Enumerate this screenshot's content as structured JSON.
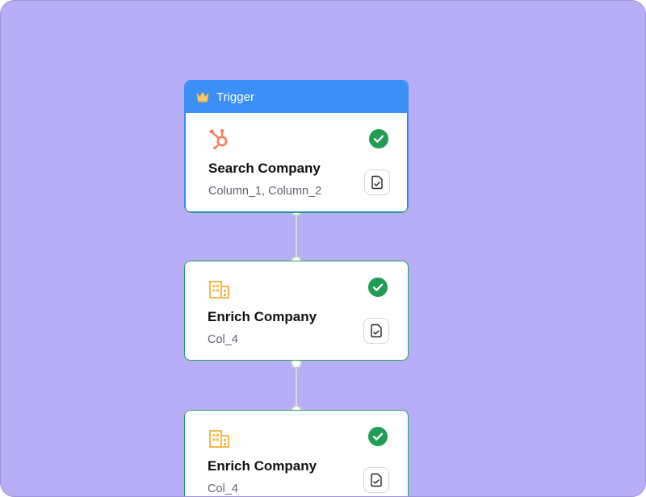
{
  "trigger": {
    "label": "Trigger",
    "icon": "crown-icon"
  },
  "nodes": [
    {
      "title": "Search Company",
      "subtitle": "Column_1, Column_2",
      "icon": "hubspot-icon",
      "status": "success"
    },
    {
      "title": "Enrich Company",
      "subtitle": "Col_4",
      "icon": "building-icon",
      "status": "success"
    },
    {
      "title": "Enrich Company",
      "subtitle": "Col_4",
      "icon": "building-icon",
      "status": "success"
    }
  ],
  "colors": {
    "canvas": "#b7aef7",
    "trigger_header": "#3b8ff5",
    "node_border": "#23a55a",
    "success": "#1f9d55",
    "hubspot": "#ff7a59",
    "building": "#f5b84a"
  }
}
